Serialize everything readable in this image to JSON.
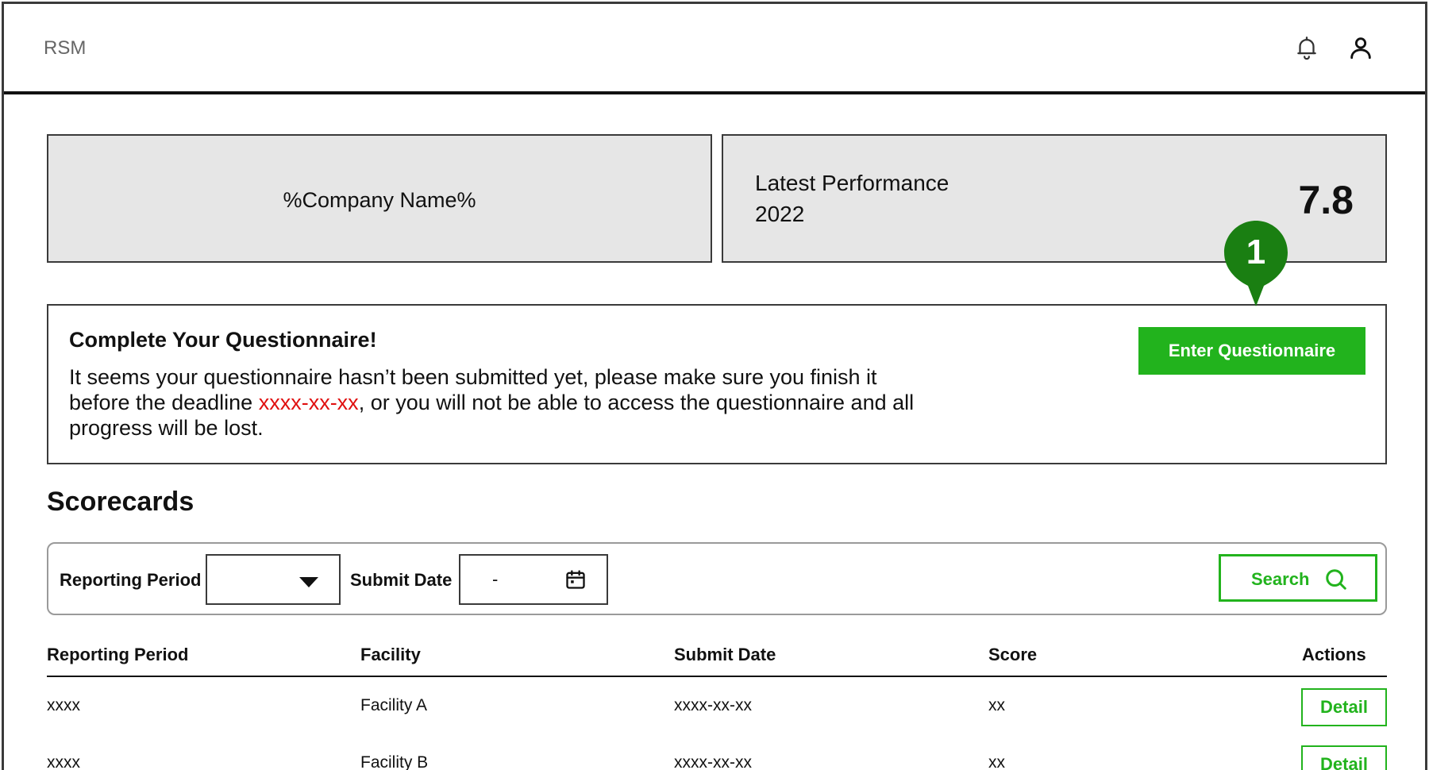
{
  "header": {
    "app_name": "RSM",
    "icons": [
      "bell-icon",
      "user-icon"
    ]
  },
  "company_card": {
    "name": "%Company Name%"
  },
  "performance_card": {
    "label": "Latest Performance",
    "year": "2022",
    "score": "7.8"
  },
  "annotation": {
    "number": "1",
    "color": "#1a7f12"
  },
  "alert": {
    "title": "Complete Your Questionnaire!",
    "text_before": "It seems your questionnaire hasn’t been submitted yet, please make sure you finish it before the deadline ",
    "deadline": "xxxx-xx-xx",
    "text_after": ", or you will not be able to access the questionnaire and all progress will be lost.",
    "button_label": "Enter Questionnaire"
  },
  "scorecards": {
    "title": "Scorecards",
    "filters": {
      "reporting_period_label": "Reporting Period",
      "reporting_period_value": "",
      "submit_date_label": "Submit Date",
      "submit_date_value": "-",
      "search_label": "Search"
    },
    "columns": [
      "Reporting Period",
      "Facility",
      "Submit Date",
      "Score",
      "Actions"
    ],
    "rows": [
      {
        "period": "xxxx",
        "facility": "Facility A",
        "submit_date": "xxxx-xx-xx",
        "score": "xx",
        "action": "Detail"
      },
      {
        "period": "xxxx",
        "facility": "Facility B",
        "submit_date": "xxxx-xx-xx",
        "score": "xx",
        "action": "Detail"
      }
    ]
  },
  "colors": {
    "accent_green": "#22b31d",
    "deadline_red": "#e01010",
    "card_gray": "#e6e6e6"
  }
}
